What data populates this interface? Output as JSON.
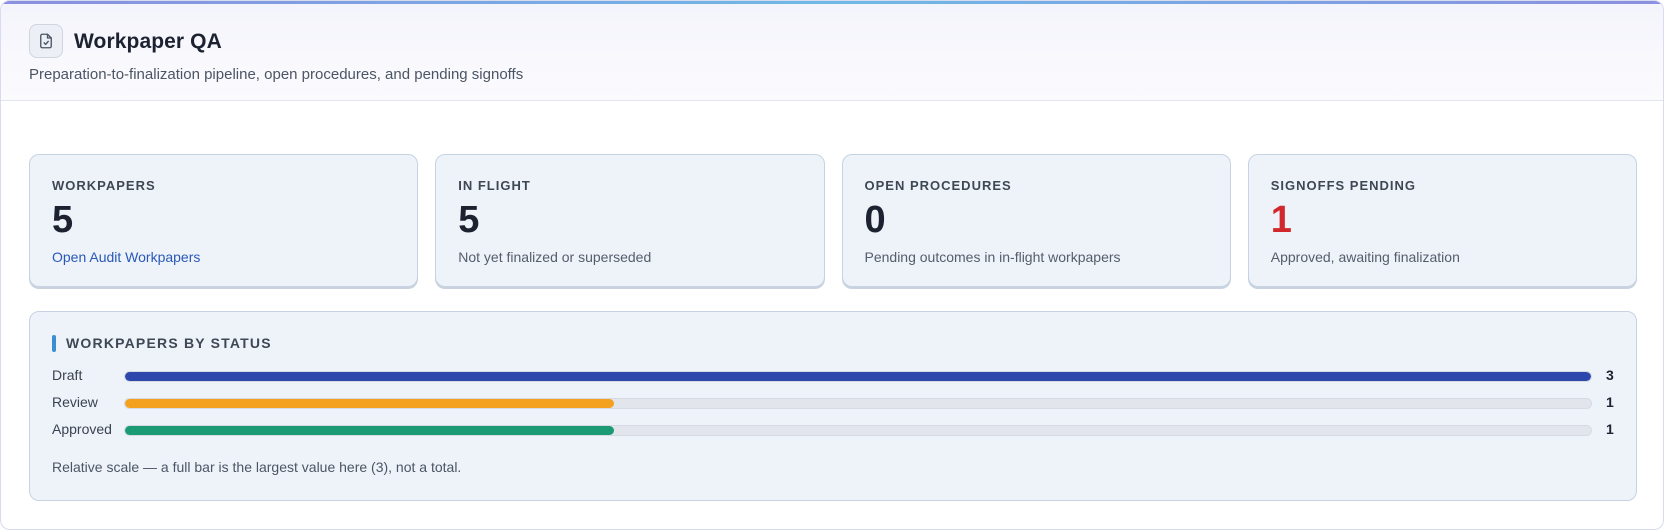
{
  "header": {
    "title": "Workpaper QA",
    "subtitle": "Preparation-to-finalization pipeline, open procedures, and pending signoffs",
    "icon": "document-check-icon"
  },
  "cards": [
    {
      "label": "WORKPAPERS",
      "value": "5",
      "note": "Open Audit Workpapers",
      "note_is_link": true
    },
    {
      "label": "IN FLIGHT",
      "value": "5",
      "note": "Not yet finalized or superseded"
    },
    {
      "label": "OPEN PROCEDURES",
      "value": "0",
      "note": "Pending outcomes in in-flight workpapers"
    },
    {
      "label": "SIGNOFFS PENDING",
      "value": "1",
      "note": "Approved, awaiting finalization",
      "value_color": "#d0282b"
    }
  ],
  "status_chart": {
    "title": "WORKPAPERS BY STATUS",
    "note": "Relative scale — a full bar is the largest value here (3), not a total."
  },
  "chart_data": {
    "type": "bar",
    "orientation": "horizontal",
    "title": "WORKPAPERS BY STATUS",
    "categories": [
      "Draft",
      "Review",
      "Approved"
    ],
    "values": [
      3,
      1,
      1
    ],
    "max": 3,
    "colors": [
      "#2e47ad",
      "#f4a11f",
      "#1a9b74"
    ]
  }
}
